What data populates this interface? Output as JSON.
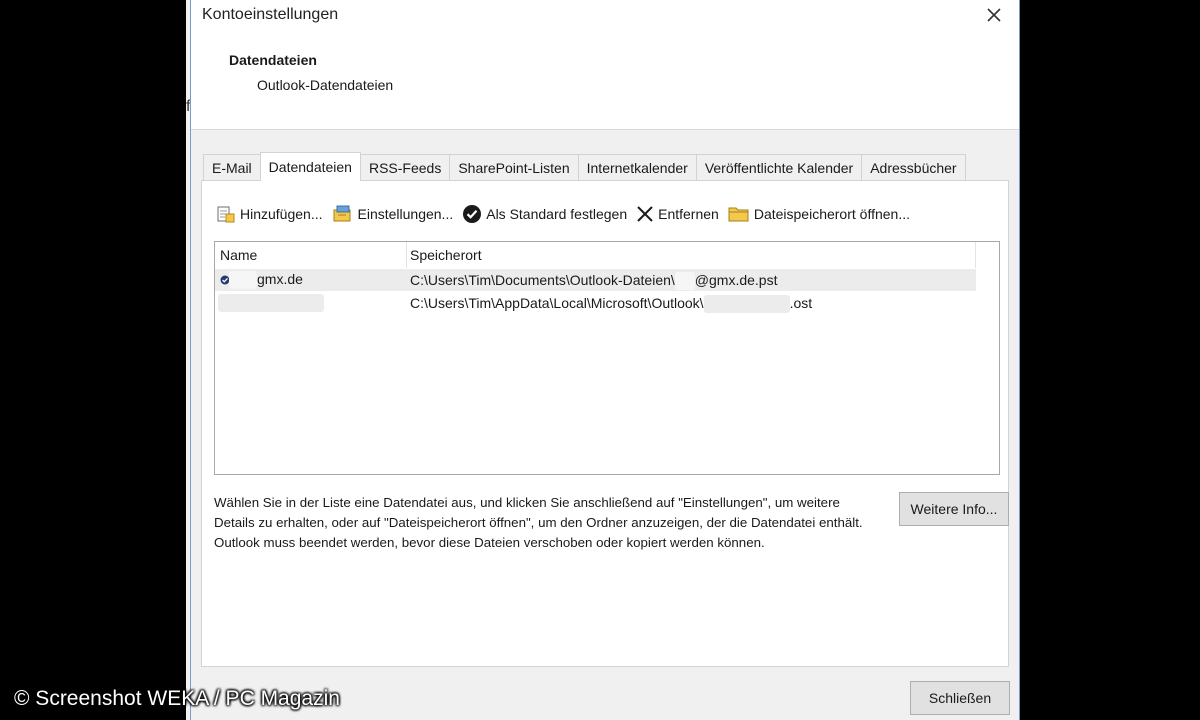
{
  "window": {
    "title": "Kontoeinstellungen"
  },
  "header": {
    "title": "Datendateien",
    "subtitle": "Outlook-Datendateien"
  },
  "tabs": [
    {
      "label": "E-Mail",
      "active": false
    },
    {
      "label": "Datendateien",
      "active": true
    },
    {
      "label": "RSS-Feeds",
      "active": false
    },
    {
      "label": "SharePoint-Listen",
      "active": false
    },
    {
      "label": "Internetkalender",
      "active": false
    },
    {
      "label": "Veröffentlichte Kalender",
      "active": false
    },
    {
      "label": "Adressbücher",
      "active": false
    }
  ],
  "toolbar": {
    "add_label": "Hinzufügen...",
    "settings_label": "Einstellungen...",
    "set_default_label": "Als Standard festlegen",
    "remove_label": "Entfernen",
    "open_location_label": "Dateispeicherort öffnen..."
  },
  "list": {
    "columns": {
      "name": "Name",
      "location": "Speicherort"
    },
    "rows": [
      {
        "name": "gmx.de",
        "location_prefix": "C:\\Users\\Tim\\Documents\\Outlook-Dateien\\",
        "location_suffix": "@gmx.de.pst",
        "is_default": true
      },
      {
        "name": "",
        "location_prefix": "C:\\Users\\Tim\\AppData\\Local\\Microsoft\\Outlook\\",
        "location_suffix": ".ost",
        "is_default": false
      }
    ]
  },
  "description": "Wählen Sie in der Liste eine Datendatei aus, und klicken Sie anschließend auf \"Einstellungen\", um weitere Details zu erhalten, oder auf \"Dateispeicherort öffnen\", um den Ordner anzuzeigen, der die Datendatei enthält. Outlook muss beendet werden, bevor diese Dateien verschoben oder kopiert werden können.",
  "buttons": {
    "more_info": "Weitere Info...",
    "close": "Schließen"
  },
  "watermark": "© Screenshot WEKA / PC Magazin",
  "colors": {
    "dialog_bg": "#f0f0f0",
    "panel_bg": "#ffffff",
    "selection": "#ececec",
    "frame": "#7a9cc6"
  },
  "icons": {
    "close": "close-icon",
    "add": "add-datafile-icon",
    "settings": "datafile-settings-icon",
    "set_default": "checkmark-circle-icon",
    "remove": "x-icon",
    "open_location": "folder-icon"
  }
}
